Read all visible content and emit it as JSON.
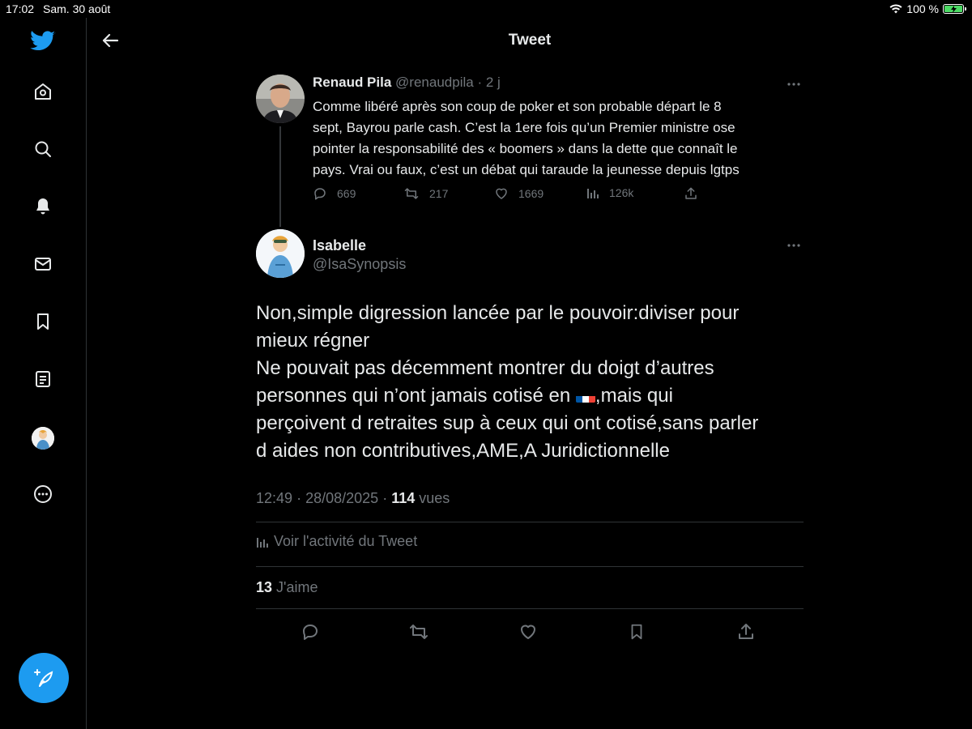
{
  "status_bar": {
    "time": "17:02",
    "date": "Sam. 30 août",
    "battery": "100 %"
  },
  "header": {
    "title": "Tweet"
  },
  "nav": {
    "items": [
      "home-icon",
      "search-icon",
      "bell-icon",
      "mail-icon",
      "bookmark-icon",
      "list-icon",
      "avatar",
      "more-icon"
    ],
    "compose": "compose-icon"
  },
  "parent_tweet": {
    "name": "Renaud Pila",
    "handle": "@renaudpila",
    "sep": "·",
    "time": "2 j",
    "text_lines": [
      "Comme libéré après son coup de poker et son probable départ le 8",
      "sept, Bayrou parle cash. C’est la 1ere fois qu’un Premier ministre ose",
      "pointer la responsabilité des « boomers » dans la dette que connaît le",
      "pays. Vrai ou faux, c’est un débat qui taraude la jeunesse depuis lgtps"
    ],
    "replies": "669",
    "retweets": "217",
    "likes": "1669",
    "views": "126k"
  },
  "tweet": {
    "name": "Isabelle",
    "handle": "@IsaSynopsis",
    "line1": "Non,simple digression lancée par le pouvoir:diviser pour",
    "line2": "mieux régner",
    "line3": "Ne pouvait pas décemment montrer du doigt d’autres",
    "line4_a": "personnes qui n’ont jamais cotisé en",
    "line4_b": ",mais qui",
    "line5": "perçoivent d retraites sup à ceux qui ont cotisé,sans parler",
    "line6": "d aides non contributives,AME,A Juridictionnelle",
    "time": "12:49",
    "sep": "·",
    "date": "28/08/2025",
    "views_count": "114",
    "views_label": "vues",
    "activity_label": "Voir l'activité du Tweet",
    "likes_count": "13",
    "likes_label": "J'aime"
  },
  "colors": {
    "accent": "#1d9bf0",
    "muted": "#71767b",
    "text": "#e7e9ea",
    "border": "#2f3336",
    "battery": "#4cd964"
  }
}
